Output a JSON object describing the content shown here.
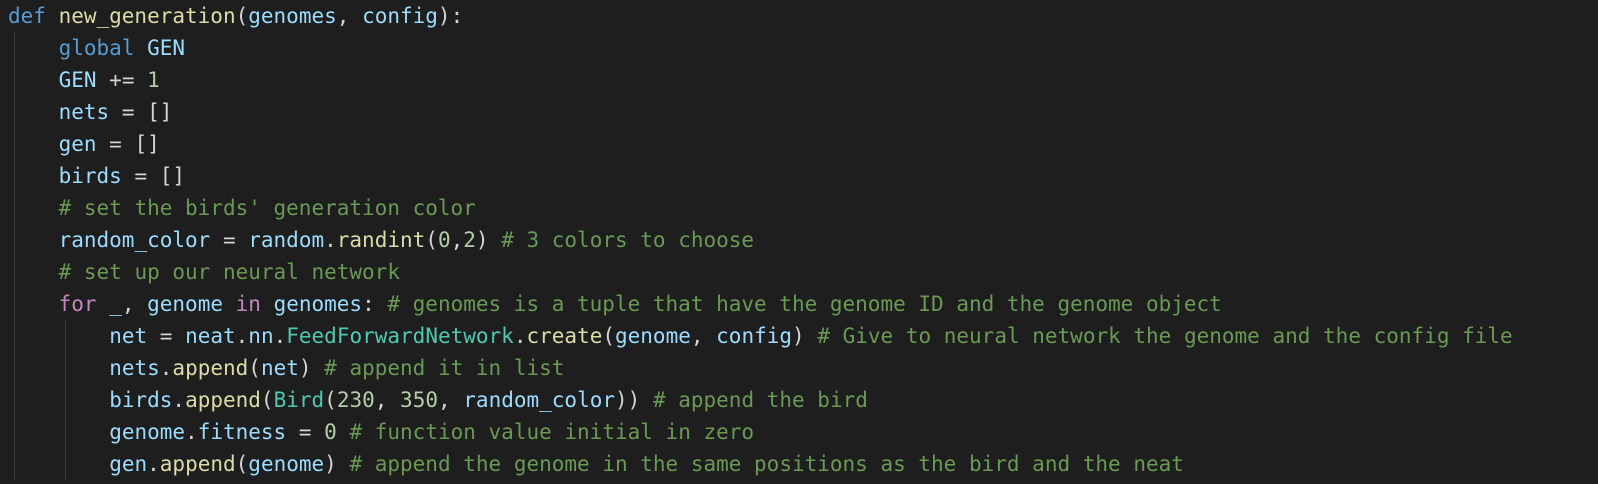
{
  "theme": {
    "background": "#1e1e1e",
    "indent_guide": "#404040",
    "colors": {
      "kw": "#569cd6",
      "ctl": "#c586c0",
      "fn": "#dcdcaa",
      "param": "#9cdcfe",
      "var": "#9cdcfe",
      "num": "#b5cea8",
      "cm": "#6a9955",
      "pl": "#d4d4d4",
      "cls": "#4ec9b0"
    }
  },
  "code_lines": [
    {
      "indent": 0,
      "tokens": [
        [
          "kw",
          "def "
        ],
        [
          "fn",
          "new_generation"
        ],
        [
          "pl",
          "("
        ],
        [
          "param",
          "genomes"
        ],
        [
          "pl",
          ", "
        ],
        [
          "param",
          "config"
        ],
        [
          "pl",
          "):"
        ]
      ]
    },
    {
      "indent": 1,
      "tokens": [
        [
          "kw",
          "global "
        ],
        [
          "var",
          "GEN"
        ]
      ]
    },
    {
      "indent": 1,
      "tokens": [
        [
          "var",
          "GEN"
        ],
        [
          "pl",
          " += "
        ],
        [
          "num",
          "1"
        ]
      ]
    },
    {
      "indent": 1,
      "tokens": [
        [
          "var",
          "nets"
        ],
        [
          "pl",
          " = []"
        ]
      ]
    },
    {
      "indent": 1,
      "tokens": [
        [
          "var",
          "gen"
        ],
        [
          "pl",
          " = []"
        ]
      ]
    },
    {
      "indent": 1,
      "tokens": [
        [
          "var",
          "birds"
        ],
        [
          "pl",
          " = []"
        ]
      ]
    },
    {
      "indent": 1,
      "tokens": [
        [
          "cm",
          "# set the birds' generation color"
        ]
      ]
    },
    {
      "indent": 1,
      "tokens": [
        [
          "var",
          "random_color"
        ],
        [
          "pl",
          " = "
        ],
        [
          "var",
          "random"
        ],
        [
          "pl",
          "."
        ],
        [
          "fn",
          "randint"
        ],
        [
          "pl",
          "("
        ],
        [
          "num",
          "0"
        ],
        [
          "pl",
          ","
        ],
        [
          "num",
          "2"
        ],
        [
          "pl",
          ") "
        ],
        [
          "cm",
          "# 3 colors to choose"
        ]
      ]
    },
    {
      "indent": 1,
      "tokens": [
        [
          "cm",
          "# set up our neural network"
        ]
      ]
    },
    {
      "indent": 1,
      "tokens": [
        [
          "ctl",
          "for "
        ],
        [
          "var",
          "_"
        ],
        [
          "pl",
          ", "
        ],
        [
          "var",
          "genome"
        ],
        [
          "ctl",
          " in "
        ],
        [
          "param",
          "genomes"
        ],
        [
          "pl",
          ": "
        ],
        [
          "cm",
          "# genomes is a tuple that have the genome ID and the genome object"
        ]
      ]
    },
    {
      "indent": 2,
      "tokens": [
        [
          "var",
          "net"
        ],
        [
          "pl",
          " = "
        ],
        [
          "var",
          "neat"
        ],
        [
          "pl",
          "."
        ],
        [
          "var",
          "nn"
        ],
        [
          "pl",
          "."
        ],
        [
          "cls",
          "FeedForwardNetwork"
        ],
        [
          "pl",
          "."
        ],
        [
          "fn",
          "create"
        ],
        [
          "pl",
          "("
        ],
        [
          "var",
          "genome"
        ],
        [
          "pl",
          ", "
        ],
        [
          "param",
          "config"
        ],
        [
          "pl",
          ") "
        ],
        [
          "cm",
          "# Give to neural network the genome and the config file"
        ]
      ]
    },
    {
      "indent": 2,
      "tokens": [
        [
          "var",
          "nets"
        ],
        [
          "pl",
          "."
        ],
        [
          "fn",
          "append"
        ],
        [
          "pl",
          "("
        ],
        [
          "var",
          "net"
        ],
        [
          "pl",
          ") "
        ],
        [
          "cm",
          "# append it in list"
        ]
      ]
    },
    {
      "indent": 2,
      "tokens": [
        [
          "var",
          "birds"
        ],
        [
          "pl",
          "."
        ],
        [
          "fn",
          "append"
        ],
        [
          "pl",
          "("
        ],
        [
          "cls",
          "Bird"
        ],
        [
          "pl",
          "("
        ],
        [
          "num",
          "230"
        ],
        [
          "pl",
          ", "
        ],
        [
          "num",
          "350"
        ],
        [
          "pl",
          ", "
        ],
        [
          "var",
          "random_color"
        ],
        [
          "pl",
          ")) "
        ],
        [
          "cm",
          "# append the bird"
        ]
      ]
    },
    {
      "indent": 2,
      "tokens": [
        [
          "var",
          "genome"
        ],
        [
          "pl",
          "."
        ],
        [
          "var",
          "fitness"
        ],
        [
          "pl",
          " = "
        ],
        [
          "num",
          "0"
        ],
        [
          "pl",
          " "
        ],
        [
          "cm",
          "# function value initial in zero"
        ]
      ]
    },
    {
      "indent": 2,
      "tokens": [
        [
          "var",
          "gen"
        ],
        [
          "pl",
          "."
        ],
        [
          "fn",
          "append"
        ],
        [
          "pl",
          "("
        ],
        [
          "var",
          "genome"
        ],
        [
          "pl",
          ") "
        ],
        [
          "cm",
          "# append the genome in the same positions as the bird and the neat"
        ]
      ]
    }
  ]
}
